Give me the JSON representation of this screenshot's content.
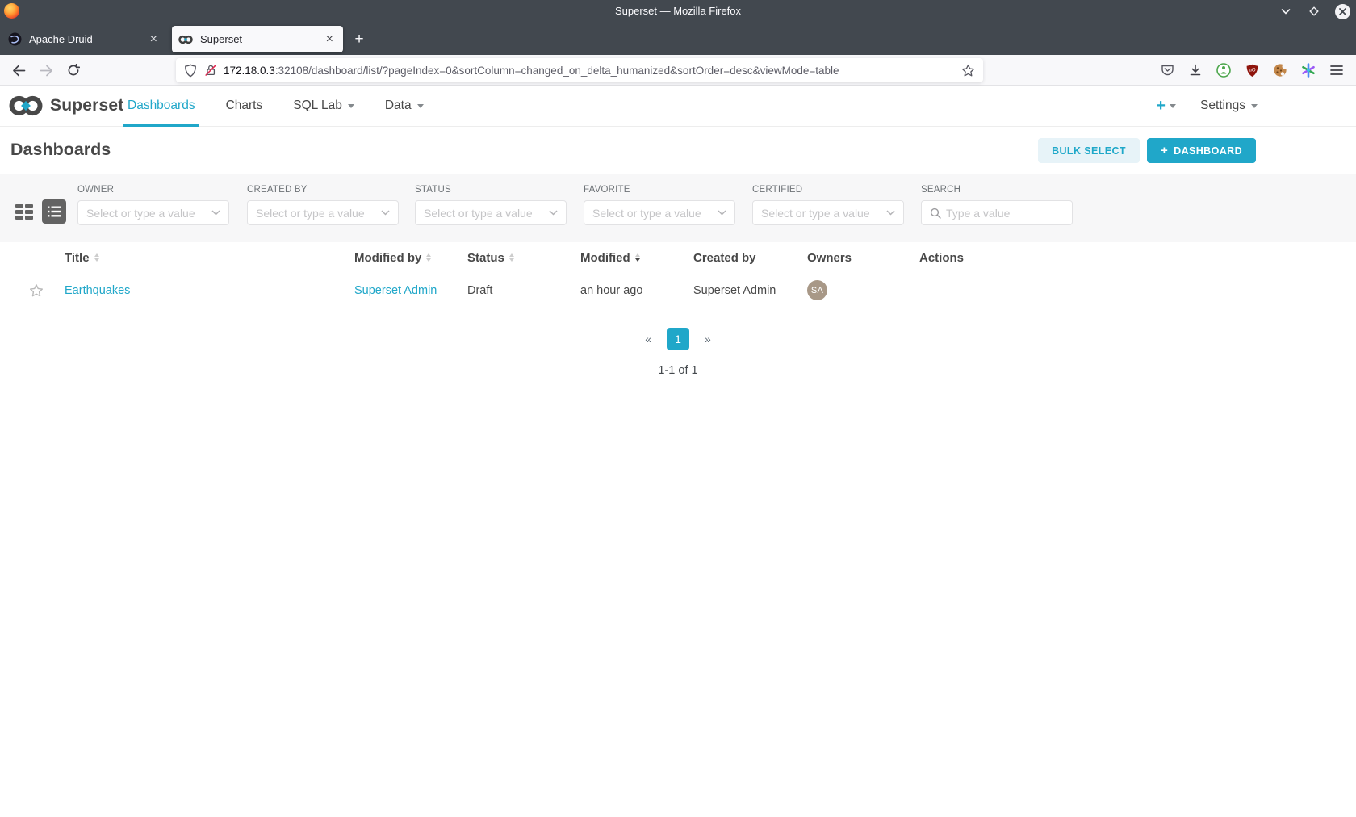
{
  "window": {
    "title": "Superset — Mozilla Firefox",
    "tabs": [
      {
        "label": "Apache Druid"
      },
      {
        "label": "Superset"
      }
    ],
    "close_glyph": "×",
    "new_tab_glyph": "+"
  },
  "urlbar": {
    "host": "172.18.0.3",
    "rest": ":32108/dashboard/list/?pageIndex=0&sortColumn=changed_on_delta_humanized&sortOrder=desc&viewMode=table"
  },
  "navbar": {
    "brand": "Superset",
    "items": [
      {
        "label": "Dashboards"
      },
      {
        "label": "Charts"
      },
      {
        "label": "SQL Lab"
      },
      {
        "label": "Data"
      }
    ],
    "plus_glyph": "+",
    "settings_label": "Settings"
  },
  "header": {
    "title": "Dashboards",
    "bulk_select_label": "BULK SELECT",
    "add_plus_glyph": "+",
    "add_dashboard_label": "DASHBOARD"
  },
  "filters": [
    {
      "label": "OWNER",
      "placeholder": "Select or type a value"
    },
    {
      "label": "CREATED BY",
      "placeholder": "Select or type a value"
    },
    {
      "label": "STATUS",
      "placeholder": "Select or type a value"
    },
    {
      "label": "FAVORITE",
      "placeholder": "Select or type a value"
    },
    {
      "label": "CERTIFIED",
      "placeholder": "Select or type a value"
    }
  ],
  "search": {
    "label": "SEARCH",
    "placeholder": "Type a value"
  },
  "table": {
    "columns": [
      "Title",
      "Modified by",
      "Status",
      "Modified",
      "Created by",
      "Owners",
      "Actions"
    ],
    "rows": [
      {
        "title": "Earthquakes",
        "modified_by": "Superset Admin",
        "status": "Draft",
        "modified": "an hour ago",
        "created_by": "Superset Admin",
        "owner_initials": "SA"
      }
    ]
  },
  "pagination": {
    "prev_glyph": "«",
    "current": "1",
    "next_glyph": "»",
    "summary": "1-1 of 1"
  },
  "colors": {
    "accent": "#20A7C9",
    "chrome_dark": "#42484F",
    "text_dark": "#484848",
    "avatar": "#A89887",
    "insecure_red": "#E22850"
  }
}
